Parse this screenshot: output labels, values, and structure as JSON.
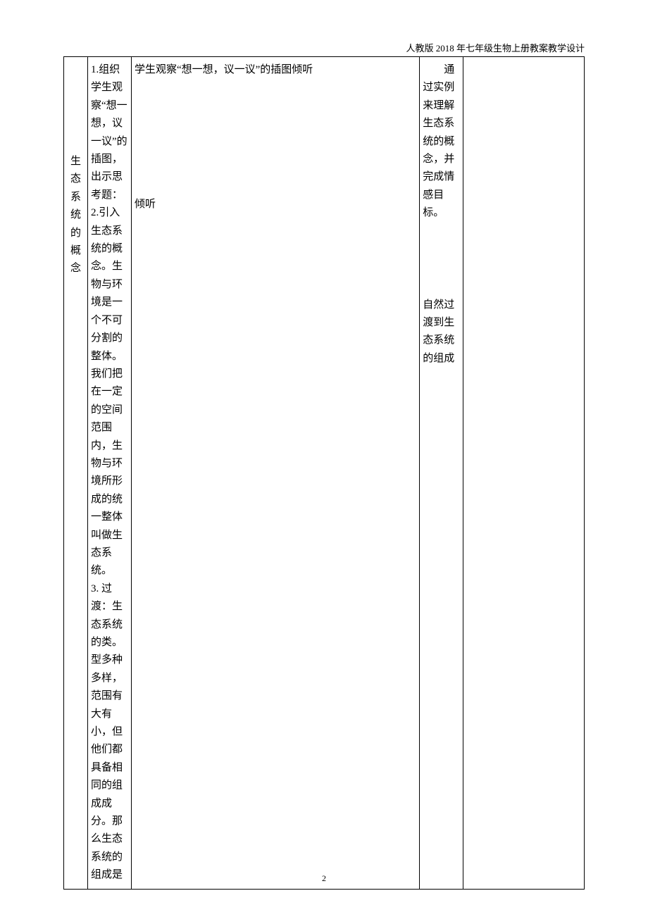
{
  "header": "人教版 2018 年七年级生物上册教案教学设计",
  "page_number": "2",
  "table": {
    "col1": "生态系统的概念",
    "col2": "1.组织学生观察“想一想，议一议”的插图，出示思考题：\n2.引入生态系统的概念。生物与环境是一个不可分割的整体。我们把在一定的空间范围内，生物与环境所形成的统一整体叫做生态系统。\n3. 过渡：生态系统的类。\n型多种多样，范围有大有小，但他们都具备相同的组成成分。那么生态系统的组成是",
    "col3_line1": "学生观察“想一想，议一议”的插图倾听",
    "col3_line2": "倾听",
    "col4_part1": "　　通过实例来理解生态系统的概念，并完成情感目标。",
    "col4_part2": "自然过渡到生态系统的组成",
    "col5": ""
  }
}
